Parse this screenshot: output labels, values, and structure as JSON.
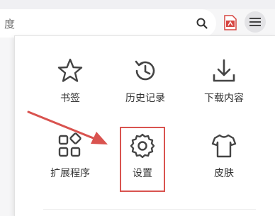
{
  "search": {
    "text": "度"
  },
  "menu": {
    "items": [
      {
        "label": "书签",
        "icon": "star-icon"
      },
      {
        "label": "历史记录",
        "icon": "history-icon"
      },
      {
        "label": "下载内容",
        "icon": "download-icon"
      },
      {
        "label": "扩展程序",
        "icon": "extensions-icon"
      },
      {
        "label": "设置",
        "icon": "gear-icon"
      },
      {
        "label": "皮肤",
        "icon": "shirt-icon"
      }
    ]
  },
  "annotation": {
    "color": "#d9534f"
  },
  "colors": {
    "icon": "#444444",
    "text": "#333333",
    "accent": "#d9534f"
  }
}
